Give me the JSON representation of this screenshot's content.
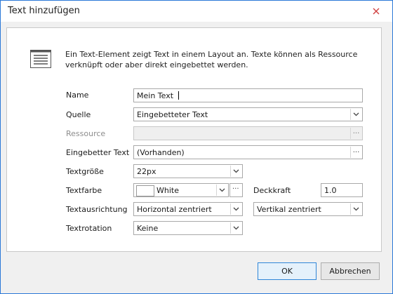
{
  "window": {
    "title": "Text hinzufügen"
  },
  "description": "Ein Text-Element zeigt Text in einem Layout an. Texte können als Ressource verknüpft oder aber direkt eingebettet werden.",
  "form": {
    "name_label": "Name",
    "name_value": "Mein Text",
    "quelle_label": "Quelle",
    "quelle_value": "Eingebetteter Text",
    "ressource_label": "Ressource",
    "ressource_value": "",
    "eingebetteter_label": "Eingebetter Text",
    "eingebetteter_value": "(Vorhanden)",
    "textgroesse_label": "Textgröße",
    "textgroesse_value": "22px",
    "textfarbe_label": "Textfarbe",
    "textfarbe_value": "White",
    "textfarbe_color": "#ffffff",
    "deckkraft_label": "Deckkraft",
    "deckkraft_value": "1.0",
    "textausrichtung_label": "Textausrichtung",
    "horizontal_value": "Horizontal zentriert",
    "vertikal_value": "Vertikal zentriert",
    "textrotation_label": "Textrotation",
    "textrotation_value": "Keine"
  },
  "buttons": {
    "ok": "OK",
    "cancel": "Abbrechen"
  },
  "icons": [
    "close-icon",
    "document-text-icon",
    "chevron-down-icon",
    "ellipsis-icon"
  ],
  "colors": {
    "accent_border": "#2b79d8",
    "close": "#d04040"
  }
}
